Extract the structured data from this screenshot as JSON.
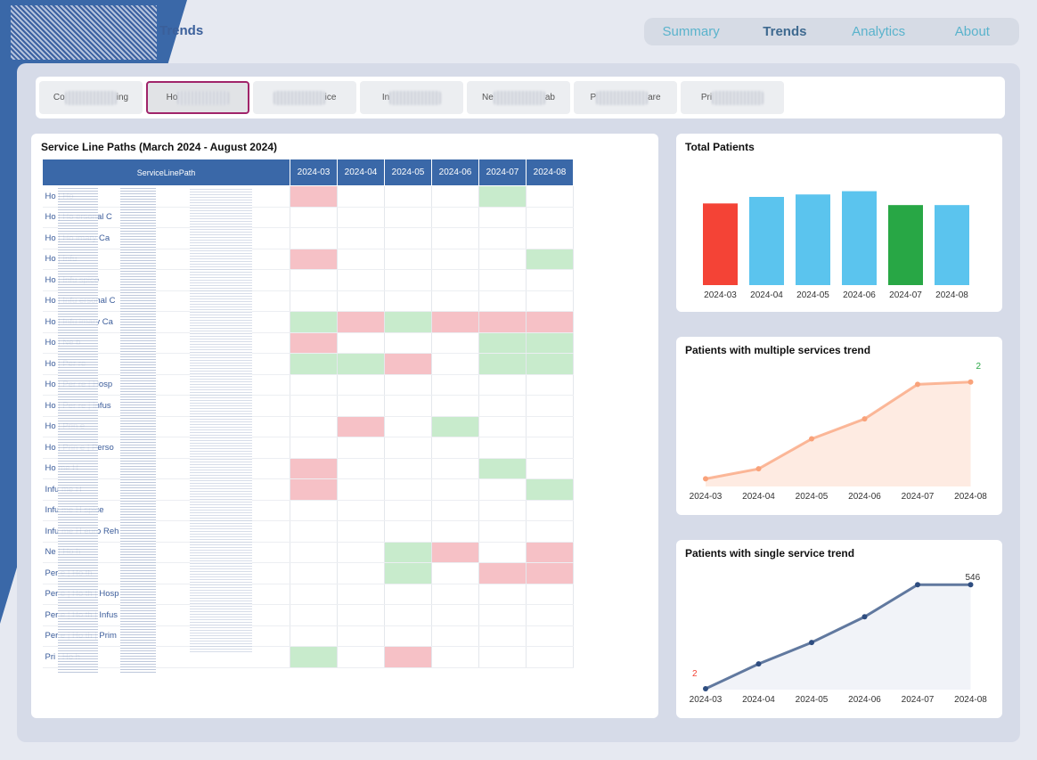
{
  "header": {
    "title": "Trends"
  },
  "nav": {
    "items": [
      {
        "label": "Summary"
      },
      {
        "label": "Trends"
      },
      {
        "label": "Analytics"
      },
      {
        "label": "About"
      }
    ]
  },
  "tabs": [
    {
      "prefix": "Co",
      "suffix": "ing"
    },
    {
      "prefix": "Ho",
      "suffix": ""
    },
    {
      "prefix": "",
      "suffix": "ice"
    },
    {
      "prefix": "In",
      "suffix": ""
    },
    {
      "prefix": "Ne",
      "suffix": "ab"
    },
    {
      "prefix": "P",
      "suffix": "are"
    },
    {
      "prefix": "Pri",
      "suffix": ""
    }
  ],
  "table": {
    "title": "Service Line Paths (March 2024 - August 2024)",
    "path_header": "ServiceLinePath",
    "months": [
      "2024-03",
      "2024-04",
      "2024-05",
      "2024-06",
      "2024-07",
      "2024-08"
    ],
    "rows": [
      {
        "path": "Ho | Ho",
        "hl": [
          "red",
          "",
          "",
          "",
          "green",
          ""
        ]
      },
      {
        "path": "Ho | Ho ersonal C",
        "hl": [
          "",
          "",
          "",
          "",
          "",
          ""
        ]
      },
      {
        "path": "Ho | Ho imary Ca",
        "hl": [
          "",
          "",
          "",
          "",
          "",
          ""
        ]
      },
      {
        "path": "Ho | Infu",
        "hl": [
          "red",
          "",
          "",
          "",
          "",
          "green"
        ]
      },
      {
        "path": "Ho | Infu spice",
        "hl": [
          "",
          "",
          "",
          "",
          "",
          ""
        ]
      },
      {
        "path": "Ho | Infu ersonal C",
        "hl": [
          "",
          "",
          "",
          "",
          "",
          ""
        ]
      },
      {
        "path": "Ho | Infu imary Ca",
        "hl": [
          "green",
          "red",
          "green",
          "red",
          "red",
          "red"
        ]
      },
      {
        "path": "Ho | Ne b",
        "hl": [
          "red",
          "",
          "",
          "",
          "green",
          "green"
        ]
      },
      {
        "path": "Ho | Per re",
        "hl": [
          "green",
          "green",
          "red",
          "",
          "green",
          "green"
        ]
      },
      {
        "path": "Ho | Per re | Hosp",
        "hl": [
          "",
          "",
          "",
          "",
          "",
          ""
        ]
      },
      {
        "path": "Ho | Per re | Infus",
        "hl": [
          "",
          "",
          "",
          "",
          "",
          ""
        ]
      },
      {
        "path": "Ho | Prin e",
        "hl": [
          "",
          "red",
          "",
          "green",
          "",
          ""
        ]
      },
      {
        "path": "Ho | Prin e | Perso",
        "hl": [
          "",
          "",
          "",
          "",
          "",
          ""
        ]
      },
      {
        "path": "Ho me H",
        "hl": [
          "red",
          "",
          "",
          "",
          "green",
          ""
        ]
      },
      {
        "path": "Infu me H",
        "hl": [
          "red",
          "",
          "",
          "",
          "",
          "green"
        ]
      },
      {
        "path": "Infu me H spice",
        "hl": [
          "",
          "",
          "",
          "",
          "",
          ""
        ]
      },
      {
        "path": "Infu me H euro Reh",
        "hl": [
          "",
          "",
          "",
          "",
          "",
          ""
        ]
      },
      {
        "path": "Ne | Ho h",
        "hl": [
          "",
          "",
          "green",
          "red",
          "",
          "red"
        ]
      },
      {
        "path": "Per e | Ho th",
        "hl": [
          "",
          "",
          "green",
          "",
          "red",
          "red"
        ]
      },
      {
        "path": "Per e | Ho th | Hosp",
        "hl": [
          "",
          "",
          "",
          "",
          "",
          ""
        ]
      },
      {
        "path": "Per e | Ho th | Infus",
        "hl": [
          "",
          "",
          "",
          "",
          "",
          ""
        ]
      },
      {
        "path": "Per e | Ho th | Prim",
        "hl": [
          "",
          "",
          "",
          "",
          "",
          ""
        ]
      },
      {
        "path": "Pri | Ho h",
        "hl": [
          "green",
          "",
          "red",
          "",
          "",
          ""
        ]
      }
    ]
  },
  "colors": {
    "primary": "#3a68a8",
    "red": "#f6c1c6",
    "green": "#c8ebcc",
    "bar_red": "#f44336",
    "bar_blue": "#5bc4ee",
    "bar_green": "#28a745",
    "line_orange": "#f9a27a",
    "line_navy": "#2e4d80"
  },
  "chart_data": [
    {
      "type": "bar",
      "title": "Total Patients",
      "categories": [
        "2024-03",
        "2024-04",
        "2024-05",
        "2024-06",
        "2024-07",
        "2024-08"
      ],
      "values": [
        100,
        108,
        111,
        115,
        98,
        98
      ],
      "colors": [
        "#f44336",
        "#5bc4ee",
        "#5bc4ee",
        "#5bc4ee",
        "#28a745",
        "#5bc4ee"
      ],
      "ylim": [
        0,
        120
      ]
    },
    {
      "type": "area",
      "title": "Patients with multiple services trend",
      "categories": [
        "2024-03",
        "2024-04",
        "2024-05",
        "2024-06",
        "2024-07",
        "2024-08"
      ],
      "values": [
        10,
        23,
        62,
        88,
        133,
        136
      ],
      "ylim": [
        0,
        145
      ],
      "visible_label": "2"
    },
    {
      "type": "area",
      "title": "Patients with single service trend",
      "categories": [
        "2024-03",
        "2024-04",
        "2024-05",
        "2024-06",
        "2024-07",
        "2024-08"
      ],
      "values": [
        2,
        60,
        110,
        170,
        245,
        245
      ],
      "ylim": [
        0,
        260
      ],
      "visible_first_label": "2",
      "visible_last_label": "546"
    }
  ]
}
